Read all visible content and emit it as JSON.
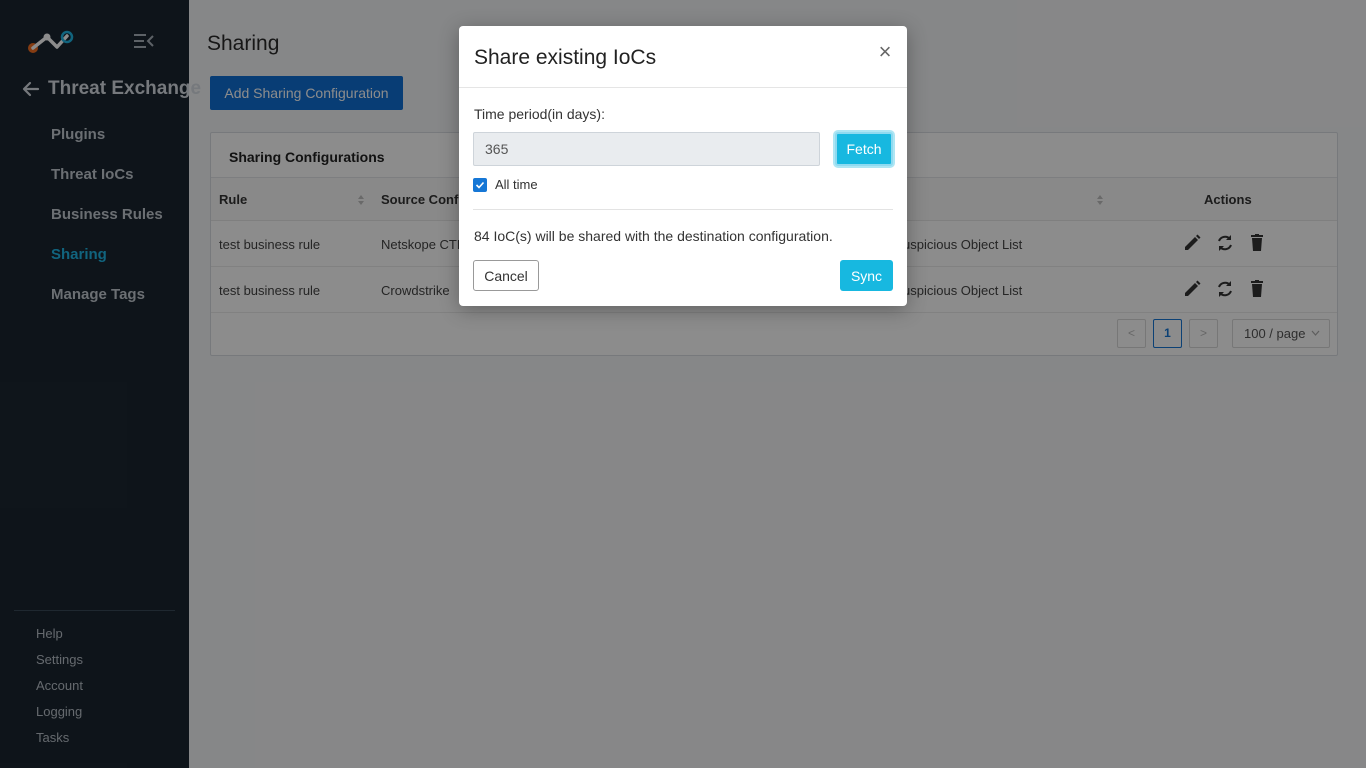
{
  "sidebar": {
    "back_title": "Threat Exchange",
    "nav": [
      {
        "label": "Plugins"
      },
      {
        "label": "Threat IoCs"
      },
      {
        "label": "Business Rules"
      },
      {
        "label": "Sharing",
        "active": true
      },
      {
        "label": "Manage Tags"
      }
    ],
    "footer": [
      {
        "label": "Help"
      },
      {
        "label": "Settings"
      },
      {
        "label": "Account"
      },
      {
        "label": "Logging"
      },
      {
        "label": "Tasks"
      }
    ]
  },
  "main": {
    "page_title": "Sharing",
    "add_button": "Add Sharing Configuration",
    "card_title": "Sharing Configurations",
    "columns": {
      "rule": "Rule",
      "source": "Source Config",
      "actions": "Actions"
    },
    "rows": [
      {
        "rule": "test business rule",
        "source": "Netskope CTE",
        "destination": "uspicious Object List"
      },
      {
        "rule": "test business rule",
        "source": "Crowdstrike",
        "destination": "uspicious Object List"
      }
    ],
    "pagination": {
      "current_page": "1",
      "prev": "<",
      "next": ">",
      "page_size": "100 / page"
    }
  },
  "modal": {
    "title": "Share existing IoCs",
    "close": "×",
    "field_label": "Time period(in days):",
    "days_value": "365",
    "fetch_button": "Fetch",
    "all_time_label": "All time",
    "all_time_checked": true,
    "info_text": "84 IoC(s) will be shared with the destination configuration.",
    "cancel_button": "Cancel",
    "sync_button": "Sync"
  },
  "colors": {
    "sidebar_bg": "#1b2631",
    "accent": "#17b8e0",
    "primary": "#0f6fd6",
    "active_nav": "#1fb6e6"
  }
}
